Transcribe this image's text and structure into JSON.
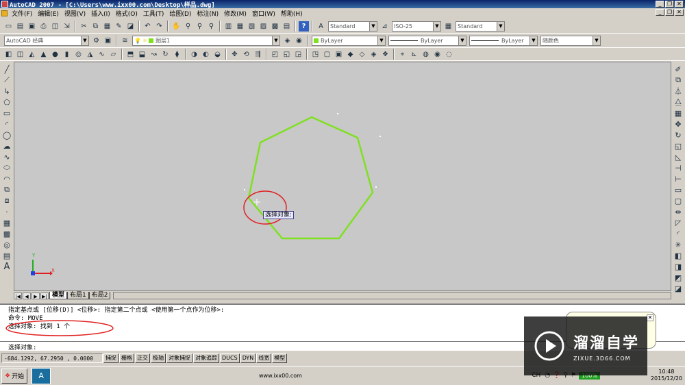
{
  "window": {
    "title": "AutoCAD 2007 - [C:\\Users\\www.ixx00.com\\Desktop\\样品.dwg]",
    "controls": [
      "_",
      "❐",
      "✕"
    ]
  },
  "menu": {
    "items": [
      "文件(F)",
      "编辑(E)",
      "视图(V)",
      "插入(I)",
      "格式(O)",
      "工具(T)",
      "绘图(D)",
      "标注(N)",
      "修改(M)",
      "窗口(W)",
      "帮助(H)"
    ]
  },
  "toolbar_styles": {
    "text_style": "Standard",
    "dim_style": "ISO-25",
    "table_style": "Standard"
  },
  "toolbar_layers": {
    "workspace": "AutoCAD 经典",
    "layer": "图层1",
    "color": "ByLayer",
    "linetype": "ByLayer",
    "lineweight": "ByLayer",
    "plotstyle": "随颜色"
  },
  "canvas": {
    "tooltip": "选择对象:",
    "ucs_y": "Y",
    "ucs_x": "X",
    "shape_color": "#7fe020"
  },
  "tabs": {
    "active": "模型",
    "others": [
      "布局1",
      "布局2"
    ]
  },
  "command_history": [
    "指定基点或 [位移(D)] <位移>:  指定第二个点或 <使用第一个点作为位移>:",
    "命令:  MOVE",
    "选择对象: 找到 1 个"
  ],
  "command_prompt": "选择对象:",
  "status": {
    "coords": "-684.1292,  67.2950 , 0.0000",
    "toggles": [
      "捕捉",
      "栅格",
      "正交",
      "极轴",
      "对象捕捉",
      "对象追踪",
      "DUCS",
      "DYN",
      "线宽",
      "模型"
    ]
  },
  "taskbar": {
    "start": "开始",
    "center_text": "www.ixx00.com",
    "ime": "CH",
    "battery": "100%",
    "time": "10:48",
    "date": "2015/12/20"
  },
  "watermark": {
    "title": "溜溜自学",
    "subtitle": "ZIXUE.3D66.COM"
  }
}
